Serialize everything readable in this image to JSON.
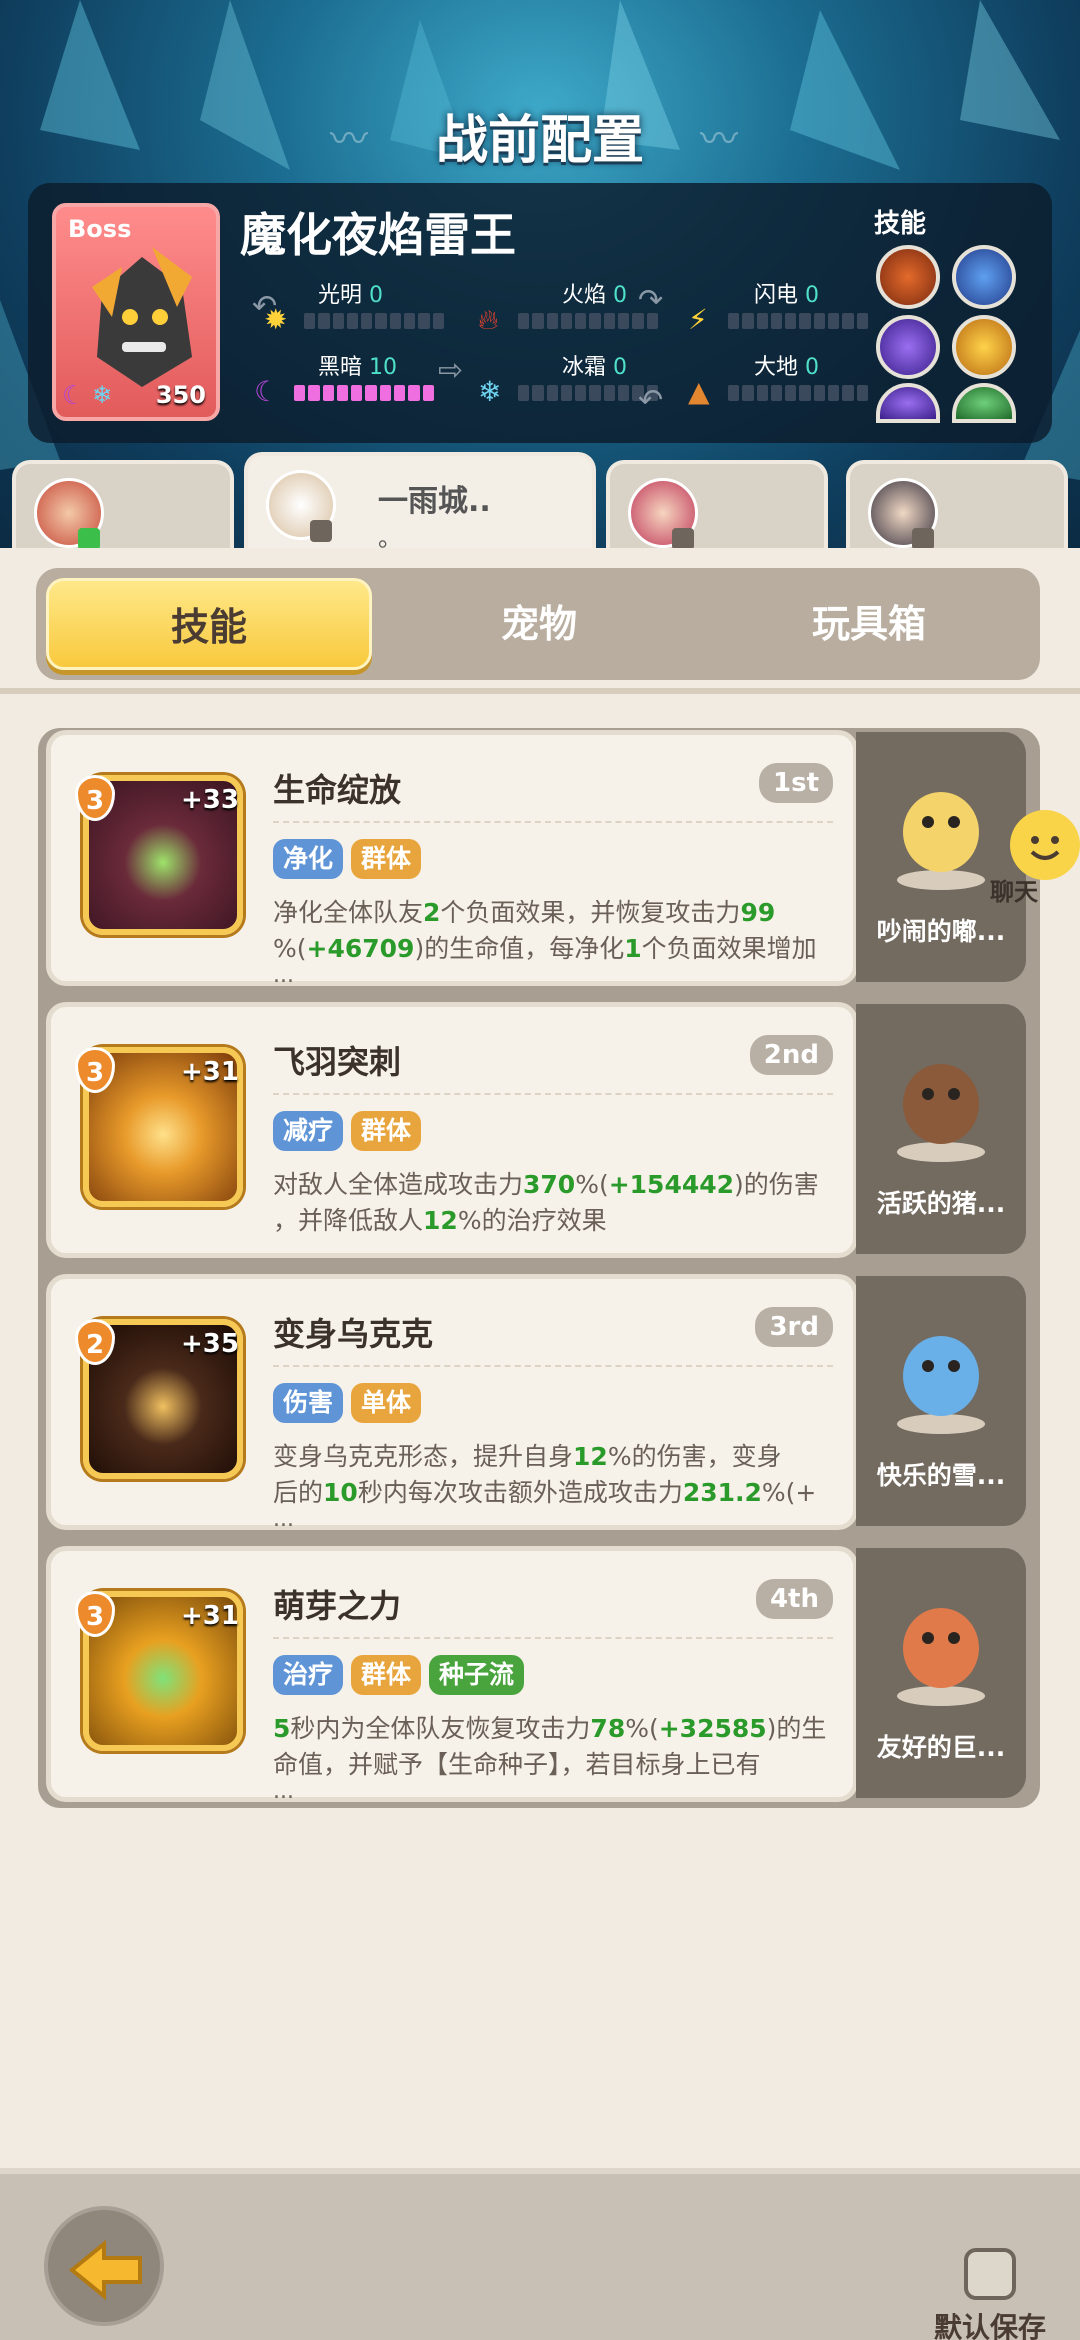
{
  "header": {
    "title": "战前配置"
  },
  "boss": {
    "tag": "Boss",
    "name": "魔化夜焰雷王",
    "level": "350",
    "skills_label": "技能",
    "elements": [
      {
        "name": "光明",
        "value": "0",
        "filled": 0,
        "icon": "sun-icon"
      },
      {
        "name": "火焰",
        "value": "0",
        "filled": 0,
        "icon": "fire-icon"
      },
      {
        "name": "闪电",
        "value": "0",
        "filled": 0,
        "icon": "lightning-icon"
      },
      {
        "name": "黑暗",
        "value": "10",
        "filled": 10,
        "icon": "moon-icon"
      },
      {
        "name": "冰霜",
        "value": "0",
        "filled": 0,
        "icon": "snowflake-icon"
      },
      {
        "name": "大地",
        "value": "0",
        "filled": 0,
        "icon": "mountain-icon"
      }
    ]
  },
  "team": [
    {
      "name": "",
      "active": false
    },
    {
      "name": "一雨城..",
      "sub": "。",
      "active": true
    },
    {
      "name": "",
      "active": false
    },
    {
      "name": "",
      "active": false
    }
  ],
  "tabs": [
    {
      "label": "技能",
      "active": true
    },
    {
      "label": "宠物",
      "active": false
    },
    {
      "label": "玩具箱",
      "active": false
    }
  ],
  "skills": [
    {
      "name": "生命绽放",
      "rank": "1st",
      "level": "3",
      "bonus": "+33",
      "tags": [
        {
          "text": "净化",
          "color": "blue"
        },
        {
          "text": "群体",
          "color": "orange"
        }
      ],
      "desc_line1": "净化全体队友2个负面效果，并恢复攻击力99",
      "desc_line2": "%(+46709)的生命值，每净化1个负面效果增加",
      "desc_more": "...",
      "pet": "吵闹的嘟..."
    },
    {
      "name": "飞羽突刺",
      "rank": "2nd",
      "level": "3",
      "bonus": "+31",
      "tags": [
        {
          "text": "减疗",
          "color": "blue"
        },
        {
          "text": "群体",
          "color": "orange"
        }
      ],
      "desc_line1": "对敌人全体造成攻击力370%(+154442)的伤害",
      "desc_line2": "，并降低敌人12%的治疗效果",
      "desc_more": "",
      "pet": "活跃的猪..."
    },
    {
      "name": "变身乌克克",
      "rank": "3rd",
      "level": "2",
      "bonus": "+35",
      "tags": [
        {
          "text": "伤害",
          "color": "blue"
        },
        {
          "text": "单体",
          "color": "orange"
        }
      ],
      "desc_line1": "变身乌克克形态，提升自身12%的伤害，变身",
      "desc_line2": "后的10秒内每次攻击额外造成攻击力231.2%(+",
      "desc_more": "...",
      "pet": "快乐的雪..."
    },
    {
      "name": "萌芽之力",
      "rank": "4th",
      "level": "3",
      "bonus": "+31",
      "tags": [
        {
          "text": "治疗",
          "color": "blue"
        },
        {
          "text": "群体",
          "color": "orange"
        },
        {
          "text": "种子流",
          "color": "green"
        }
      ],
      "desc_line1": "5秒内为全体队友恢复攻击力78%(+32585)的生",
      "desc_line2": "命值，并赋予【生命种子】，若目标身上已有",
      "desc_more": "...",
      "pet": "友好的巨..."
    }
  ],
  "chat": {
    "label": "聊天"
  },
  "footer": {
    "save_label": "默认保存"
  }
}
